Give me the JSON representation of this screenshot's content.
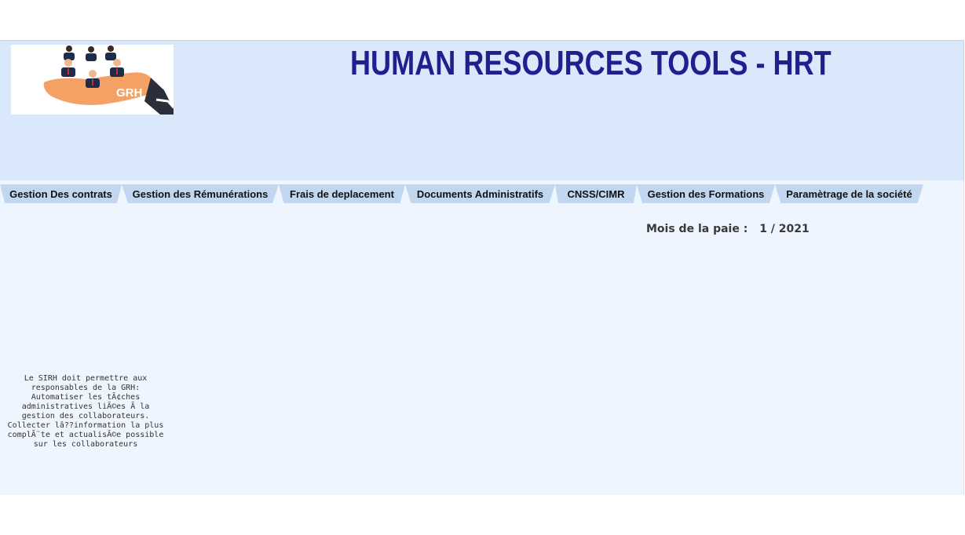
{
  "header": {
    "title": "HUMAN RESOURCES TOOLS - HRT",
    "logo_text": "GRH"
  },
  "nav": {
    "items": [
      {
        "label": "Gestion Des contrats"
      },
      {
        "label": "Gestion des Rémunérations"
      },
      {
        "label": "Frais de deplacement"
      },
      {
        "label": "Documents Administratifs"
      },
      {
        "label": "CNSS/CIMR"
      },
      {
        "label": "Gestion des Formations"
      },
      {
        "label": "Paramètrage de la société"
      }
    ]
  },
  "payroll": {
    "label": "Mois de la paie :",
    "value": "1 / 2021"
  },
  "description": "Le SIRH doit permettre aux responsables de la GRH: Automatiser les tÃ¢ches administratives liÃ©es Ã  la gestion des collaborateurs. Collecter lâ??information la plus complÃ¨te et actualisÃ©e possible sur les collaborateurs",
  "colors": {
    "title": "#1f1f8f",
    "header_bg": "#d9e8fb",
    "tab_bg": "#c1d6ef",
    "content_bg": "#eef5fe"
  }
}
